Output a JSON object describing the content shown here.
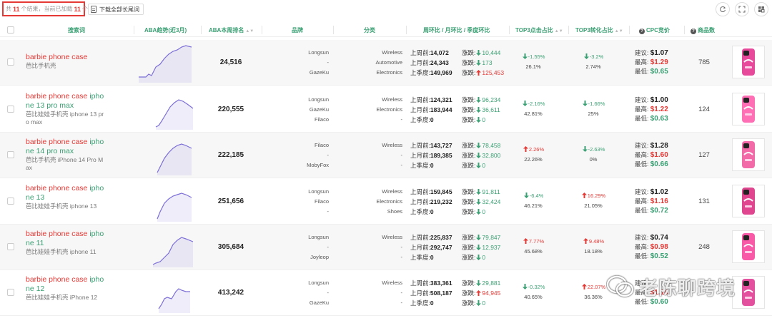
{
  "toolbar": {
    "result_prefix": "共",
    "result_total": "11",
    "result_mid": "个结果，当前已加载",
    "result_loaded": "11",
    "result_suffix": "个",
    "download_label": "下载全部长尾词",
    "icons": [
      "refresh-icon",
      "expand-icon",
      "grid-settings-icon"
    ]
  },
  "columns": {
    "keyword": "搜索词",
    "aba_trend": "ABA趋势(近3月)",
    "aba_rank": "ABA本周排名",
    "brand": "品牌",
    "category": "分类",
    "trend": "周环比 / 月环比 / 季度环比",
    "top3_click": "TOP3点击占比",
    "top3_conv": "TOP3转化占比",
    "cpc": "CPC竞价",
    "products": "商品数"
  },
  "labels": {
    "last_week": "上周前:",
    "last_month": "上月前:",
    "last_quarter": "上季度:",
    "change": "涨跌:",
    "suggest": "建议:",
    "max": "最高:",
    "min": "最低:"
  },
  "rows": [
    {
      "kw_red": "barbie phone case",
      "kw_green": "",
      "kw_zh": "芭比手机壳",
      "rank": "24,516",
      "brands": [
        "Longsun",
        "-",
        "GazeKu"
      ],
      "categories": [
        "Wireless",
        "Automotive",
        "Electronics"
      ],
      "week": "14,072",
      "week_chg": "10,444",
      "week_dir": "down",
      "month": "24,343",
      "month_chg": "173",
      "month_dir": "down",
      "quarter": "149,969",
      "quarter_chg": "125,453",
      "quarter_dir": "up",
      "click_chg": "-1.55%",
      "click_dir": "down",
      "click_val": "26.1%",
      "conv_chg": "-3.2%",
      "conv_dir": "down",
      "conv_val": "2.74%",
      "cpc_suggest": "$1.07",
      "cpc_max": "$1.29",
      "cpc_min": "$0.65",
      "products": "785"
    },
    {
      "kw_red": "barbie phone case ",
      "kw_green": "iphone 13 pro max",
      "kw_zh": "芭比娃娃手机壳 iphone 13 pro max",
      "rank": "220,555",
      "brands": [
        "Longsun",
        "GazeKu",
        "Filaco"
      ],
      "categories": [
        "Wireless",
        "Electronics",
        "-"
      ],
      "week": "124,321",
      "week_chg": "96,234",
      "week_dir": "down",
      "month": "183,944",
      "month_chg": "36,611",
      "month_dir": "down",
      "quarter": "0",
      "quarter_chg": "0",
      "quarter_dir": "down",
      "click_chg": "-2.16%",
      "click_dir": "down",
      "click_val": "42.81%",
      "conv_chg": "-1.66%",
      "conv_dir": "down",
      "conv_val": "25%",
      "cpc_suggest": "$1.00",
      "cpc_max": "$1.22",
      "cpc_min": "$0.63",
      "products": "124"
    },
    {
      "kw_red": "barbie phone case ",
      "kw_green": "iphone 14 pro max",
      "kw_zh": "芭比手机壳 iPhone 14 Pro Max",
      "rank": "222,185",
      "brands": [
        "Filaco",
        "-",
        "MobyFox"
      ],
      "categories": [
        "Wireless",
        "-",
        "-"
      ],
      "week": "143,727",
      "week_chg": "78,458",
      "week_dir": "down",
      "month": "189,385",
      "month_chg": "32,800",
      "month_dir": "down",
      "quarter": "0",
      "quarter_chg": "0",
      "quarter_dir": "down",
      "click_chg": "2.26%",
      "click_dir": "up",
      "click_val": "22.26%",
      "conv_chg": "-2.63%",
      "conv_dir": "down",
      "conv_val": "0%",
      "cpc_suggest": "$1.28",
      "cpc_max": "$1.60",
      "cpc_min": "$0.66",
      "products": "127"
    },
    {
      "kw_red": "barbie phone case ",
      "kw_green": "iphone 13",
      "kw_zh": "芭比娃娃手机壳 iphone 13",
      "rank": "251,656",
      "brands": [
        "Longsun",
        "Filaco",
        "-"
      ],
      "categories": [
        "Wireless",
        "Electronics",
        "Shoes"
      ],
      "week": "159,845",
      "week_chg": "91,811",
      "week_dir": "down",
      "month": "219,232",
      "month_chg": "32,424",
      "month_dir": "down",
      "quarter": "0",
      "quarter_chg": "0",
      "quarter_dir": "down",
      "click_chg": "-6.4%",
      "click_dir": "down",
      "click_val": "46.21%",
      "conv_chg": "16.29%",
      "conv_dir": "up",
      "conv_val": "21.05%",
      "cpc_suggest": "$1.02",
      "cpc_max": "$1.16",
      "cpc_min": "$0.72",
      "products": "131"
    },
    {
      "kw_red": "barbie phone case ",
      "kw_green": "iphone 11",
      "kw_zh": "芭比娃娃手机壳 iphone 11",
      "rank": "305,684",
      "brands": [
        "Longsun",
        "-",
        "Joyleop"
      ],
      "categories": [
        "Wireless",
        "-",
        "-"
      ],
      "week": "225,837",
      "week_chg": "79,847",
      "week_dir": "down",
      "month": "292,747",
      "month_chg": "12,937",
      "month_dir": "down",
      "quarter": "0",
      "quarter_chg": "0",
      "quarter_dir": "down",
      "click_chg": "7.77%",
      "click_dir": "up",
      "click_val": "45.68%",
      "conv_chg": "9.48%",
      "conv_dir": "up",
      "conv_val": "18.18%",
      "cpc_suggest": "$0.74",
      "cpc_max": "$0.98",
      "cpc_min": "$0.52",
      "products": "248"
    },
    {
      "kw_red": "barbie phone case ",
      "kw_green": "iphone 12",
      "kw_zh": "芭比娃娃手机壳 iPhone 12",
      "rank": "413,242",
      "brands": [
        "Longsun",
        "-",
        "GazeKu"
      ],
      "categories": [
        "Wireless",
        "-",
        "-"
      ],
      "week": "383,361",
      "week_chg": "29,881",
      "week_dir": "down",
      "month": "508,187",
      "month_chg": "94,945",
      "month_dir": "up",
      "quarter": "0",
      "quarter_chg": "0",
      "quarter_dir": "down",
      "click_chg": "-0.32%",
      "click_dir": "down",
      "click_val": "40.65%",
      "conv_chg": "22.07%",
      "conv_dir": "up",
      "conv_val": "36.36%",
      "cpc_suggest": "",
      "cpc_max": "$1.14",
      "cpc_min": "$0.60",
      "products": ""
    }
  ],
  "watermark": "老陈聊跨境",
  "colors": {
    "accent": "#3a9f73",
    "up": "#e53935",
    "down": "#3a9f73",
    "spark": "#7c6fd6"
  }
}
